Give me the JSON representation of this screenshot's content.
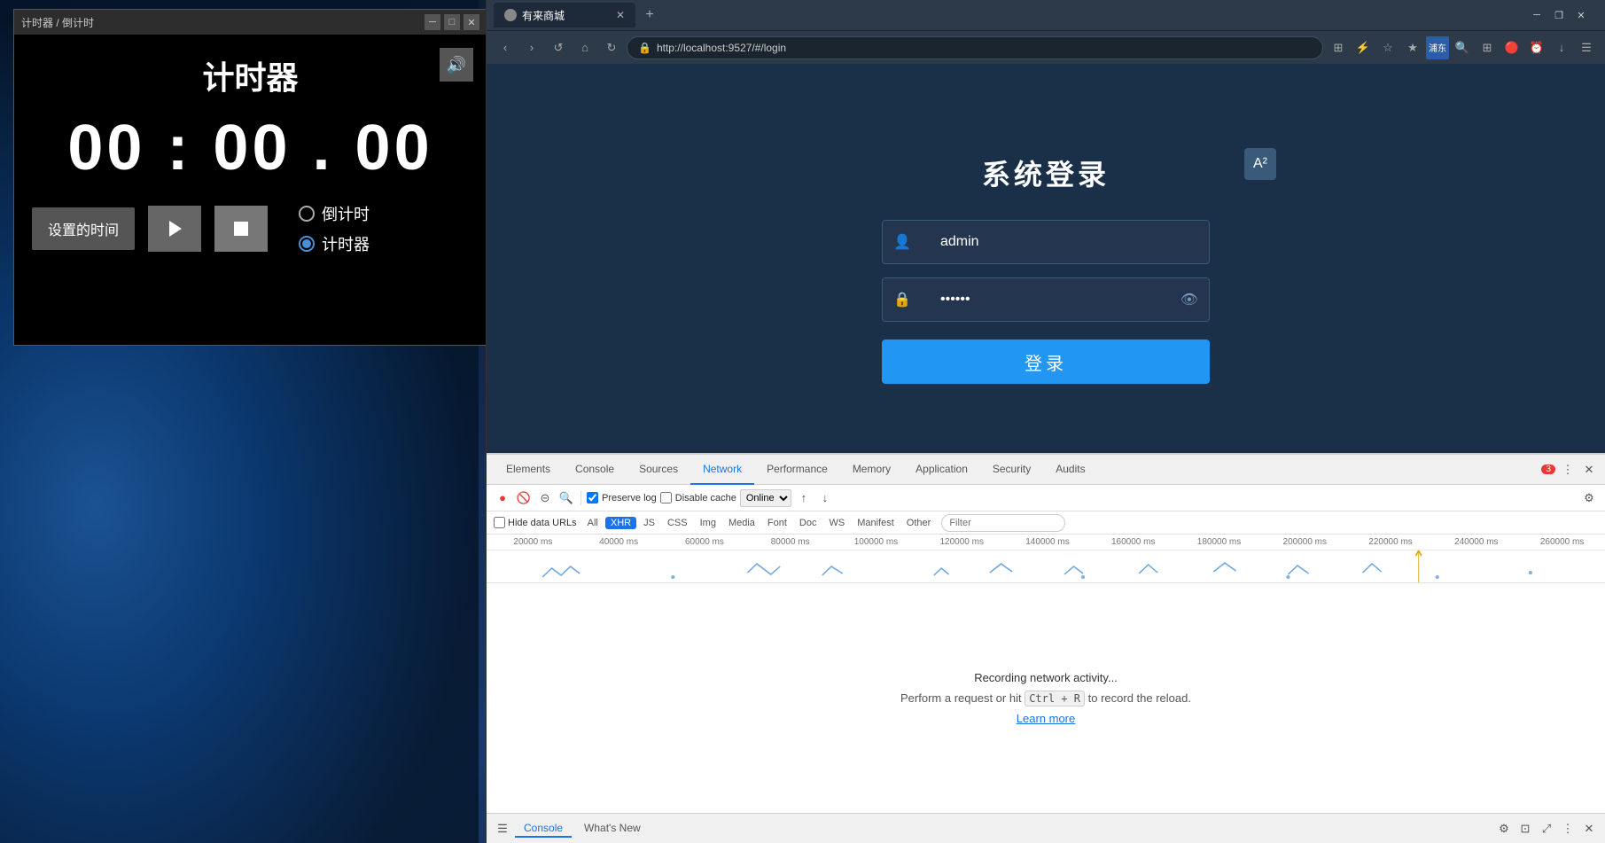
{
  "desktop": {
    "background": "nebula"
  },
  "timer_window": {
    "title": "计时器 / 倒计时",
    "controls": {
      "minimize": "─",
      "maximize": "□",
      "close": "✕"
    },
    "heading": "计时器",
    "display": "00 : 00 . 00",
    "set_time_btn": "设置的时间",
    "radio_countdown": "倒计时",
    "radio_timer": "计时器",
    "selected_radio": "timer"
  },
  "browser": {
    "tab_title": "有来商城",
    "tab_favicon": "circle",
    "address": "http://localhost:9527/#/login",
    "nav_back": "‹",
    "nav_forward": "›",
    "nav_home": "⌂",
    "nav_refresh": "↺",
    "nav_star": "☆",
    "nav_star2": "★",
    "nav_reload": "↻",
    "win_minimize": "─",
    "win_restore": "❐",
    "win_close": "✕"
  },
  "login_page": {
    "title": "系统登录",
    "username_placeholder": "admin",
    "password_value": "••••••",
    "login_btn": "登录"
  },
  "devtools": {
    "tabs": [
      "Elements",
      "Console",
      "Sources",
      "Network",
      "Performance",
      "Memory",
      "Application",
      "Security",
      "Audits"
    ],
    "active_tab": "Network",
    "error_count": "3",
    "toolbar": {
      "record": "●",
      "clear": "🚫",
      "filter": "⊝",
      "search": "🔍",
      "preserve_log_checked": true,
      "preserve_log_label": "Preserve log",
      "disable_cache_checked": false,
      "disable_cache_label": "Disable cache",
      "online_label": "Online",
      "upload": "↑",
      "download": "↓"
    },
    "filter_bar": {
      "placeholder": "Filter",
      "hide_data_urls": "Hide data URLs",
      "tabs": [
        "All",
        "XHR",
        "JS",
        "CSS",
        "Img",
        "Media",
        "Font",
        "Doc",
        "WS",
        "Manifest",
        "Other"
      ]
    },
    "timeline_labels": [
      "20000 ms",
      "40000 ms",
      "60000 ms",
      "80000 ms",
      "100000 ms",
      "120000 ms",
      "140000 ms",
      "160000 ms",
      "180000 ms",
      "200000 ms",
      "220000 ms",
      "240000 ms",
      "260000 ms"
    ],
    "network_empty": {
      "main_text": "Recording network activity...",
      "sub_text": "Perform a request or hit",
      "shortcut": "Ctrl + R",
      "sub_text2": "to record the reload.",
      "learn_more": "Learn more"
    },
    "bottom_tabs": [
      "Console",
      "What's New"
    ],
    "active_bottom_tab": "Console"
  }
}
